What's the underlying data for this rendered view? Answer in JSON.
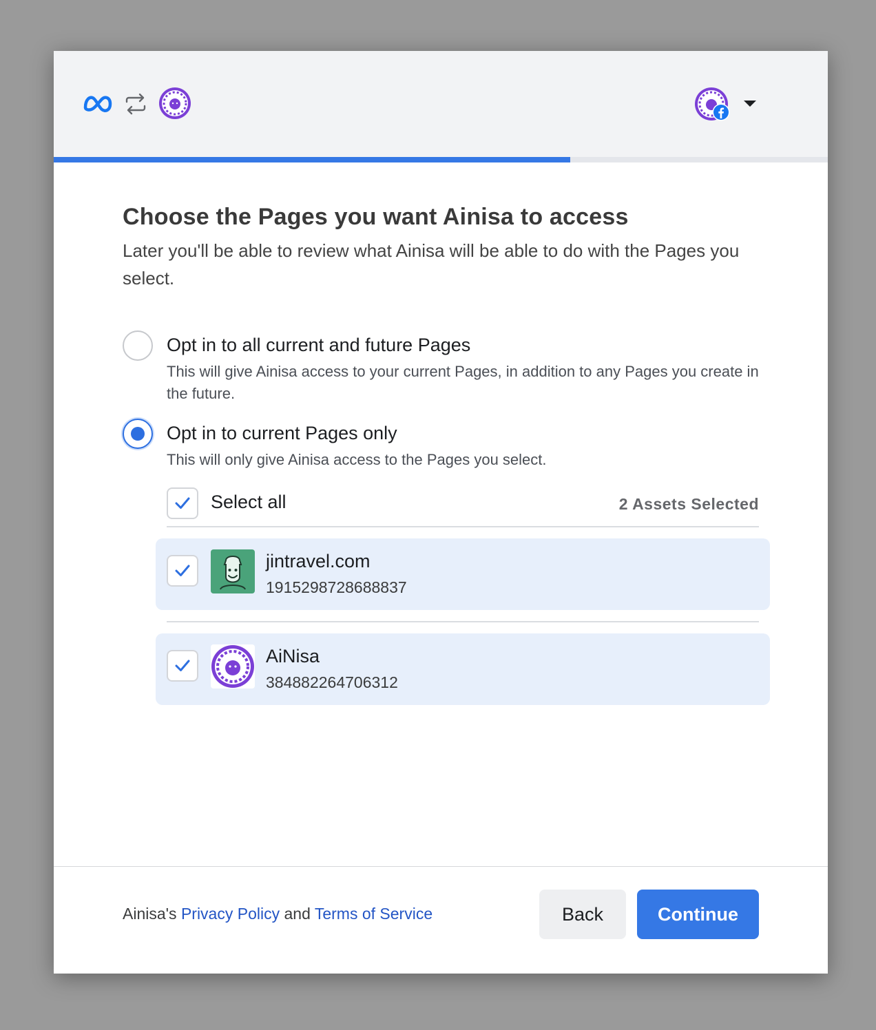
{
  "header": {
    "meta_logo_icon": "meta-infinity-logo",
    "swap_icon": "swap-arrows-icon",
    "app_avatar_icon": "ainisa-avatar",
    "user_avatar_icon": "user-avatar-with-facebook-badge",
    "menu_icon": "caret-down-icon",
    "progress_fraction": 0.667
  },
  "main": {
    "title": "Choose the Pages you want Ainisa to access",
    "subtitle": "Later you'll be able to review what Ainisa will be able to do with the Pages you select.",
    "options": [
      {
        "label": "Opt in to all current and future Pages",
        "description": "This will give Ainisa access to your current Pages, in addition to any Pages you create in the future.",
        "selected": false
      },
      {
        "label": "Opt in to current Pages only",
        "description": "This will only give Ainisa access to the Pages you select.",
        "selected": true
      }
    ],
    "select_all_label": "Select all",
    "select_all_checked": true,
    "assets_selected": "2 Assets Selected",
    "pages": [
      {
        "name": "jintravel.com",
        "id": "1915298728688837",
        "checked": true,
        "avatar": "jintravel-avatar"
      },
      {
        "name": "AiNisa",
        "id": "384882264706312",
        "checked": true,
        "avatar": "ainisa-avatar"
      }
    ]
  },
  "footer": {
    "legal_prefix": "Ainisa's ",
    "privacy_label": "Privacy Policy",
    "and_text": " and ",
    "terms_label": "Terms of Service",
    "back_label": "Back",
    "continue_label": "Continue"
  },
  "colors": {
    "accent": "#3578e5",
    "link": "#2355c5",
    "row_highlight": "#e7effb",
    "header_bg": "#f2f3f5",
    "jintravel_green": "#4aa37a",
    "ainisa_purple": "#7b3fd6"
  }
}
